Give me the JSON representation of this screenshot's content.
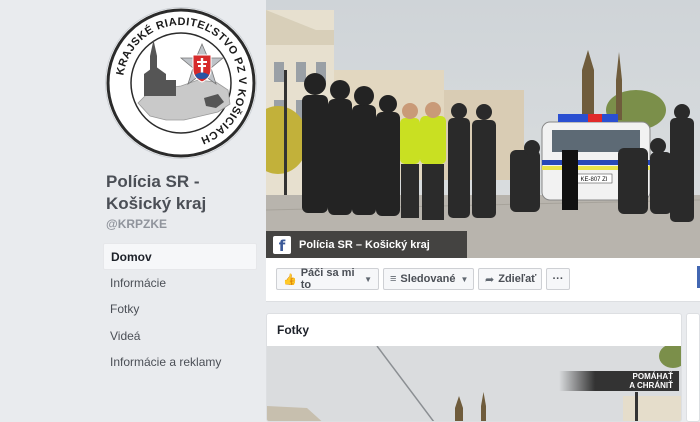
{
  "page": {
    "name_line1": "Polícia SR -",
    "name_line2": "Košický kraj",
    "handle": "@KRPZKE"
  },
  "logo": {
    "ring_text": "KRAJSKÉ RIADITEĽSTVO PZ V KOŠICIACH"
  },
  "nav": {
    "items": [
      {
        "label": "Domov",
        "active": true
      },
      {
        "label": "Informácie"
      },
      {
        "label": "Fotky"
      },
      {
        "label": "Videá"
      },
      {
        "label": "Informácie a reklamy"
      }
    ]
  },
  "cover": {
    "label": "Polícia SR – Košický kraj",
    "fb_icon": "f",
    "car_plate": "KE-807 ZI",
    "car_text": "POLÍCIA"
  },
  "actions": {
    "like": "Páči sa mi to",
    "follow": "Sledované",
    "share": "Zdieľať",
    "more": "···"
  },
  "photos": {
    "title": "Fotky",
    "banner_line1": "POMÁHAŤ",
    "banner_line2": "A CHRÁNIŤ"
  },
  "colors": {
    "background": "#e9ebee",
    "brand": "#3b5998",
    "vest": "#c9e022"
  }
}
